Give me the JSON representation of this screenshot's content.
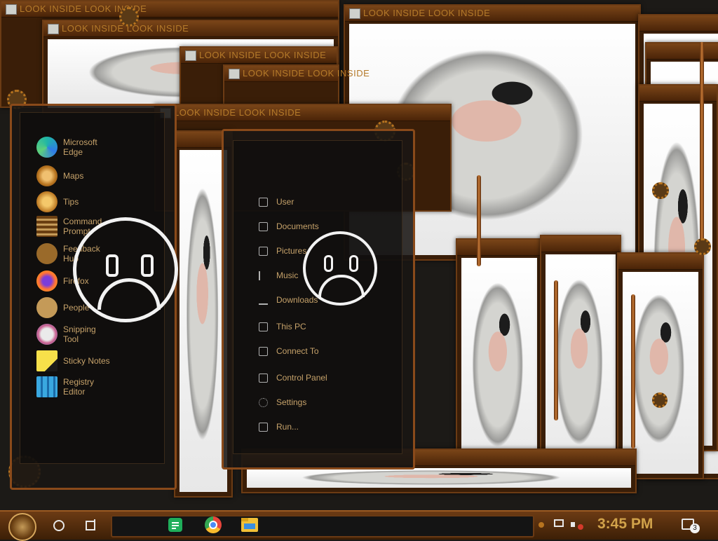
{
  "colors": {
    "accent_text": "#c6a26a",
    "title_text": "#b57a2a",
    "frame": "#6b3b14",
    "clock": "#d1a24a"
  },
  "windows": {
    "title": "LOOK INSIDE LOOK INSIDE"
  },
  "apps_list": [
    {
      "label": "Microsoft Edge",
      "icon": "edge-icon"
    },
    {
      "label": "Maps",
      "icon": "maps-icon"
    },
    {
      "label": "Tips",
      "icon": "lightbulb-icon"
    },
    {
      "label": "Command Prompt",
      "icon": "command-prompt-icon"
    },
    {
      "label": "Feedback Hub",
      "icon": "feedback-hub-icon"
    },
    {
      "label": "Firefox",
      "icon": "firefox-icon"
    },
    {
      "label": "People",
      "icon": "people-icon"
    },
    {
      "label": "Snipping Tool",
      "icon": "snipping-tool-icon"
    },
    {
      "label": "Sticky Notes",
      "icon": "sticky-notes-icon"
    },
    {
      "label": "Registry Editor",
      "icon": "registry-editor-icon"
    }
  ],
  "places_list": [
    {
      "label": "User",
      "icon": "user-icon"
    },
    {
      "label": "Documents",
      "icon": "document-icon"
    },
    {
      "label": "Pictures",
      "icon": "picture-icon"
    },
    {
      "label": "Music",
      "icon": "music-note-icon"
    },
    {
      "label": "Downloads",
      "icon": "download-icon"
    },
    {
      "label": "This PC",
      "icon": "computer-icon"
    },
    {
      "label": "Connect To",
      "icon": "network-icon"
    },
    {
      "label": "Control Panel",
      "icon": "control-panel-icon"
    },
    {
      "label": "Settings",
      "icon": "gear-icon"
    },
    {
      "label": "Run...",
      "icon": "run-icon"
    }
  ],
  "taskbar": {
    "clock": "3:45 PM",
    "notification_count": "3",
    "pinned": [
      "google-sheets-icon",
      "chrome-icon",
      "file-explorer-icon"
    ]
  }
}
